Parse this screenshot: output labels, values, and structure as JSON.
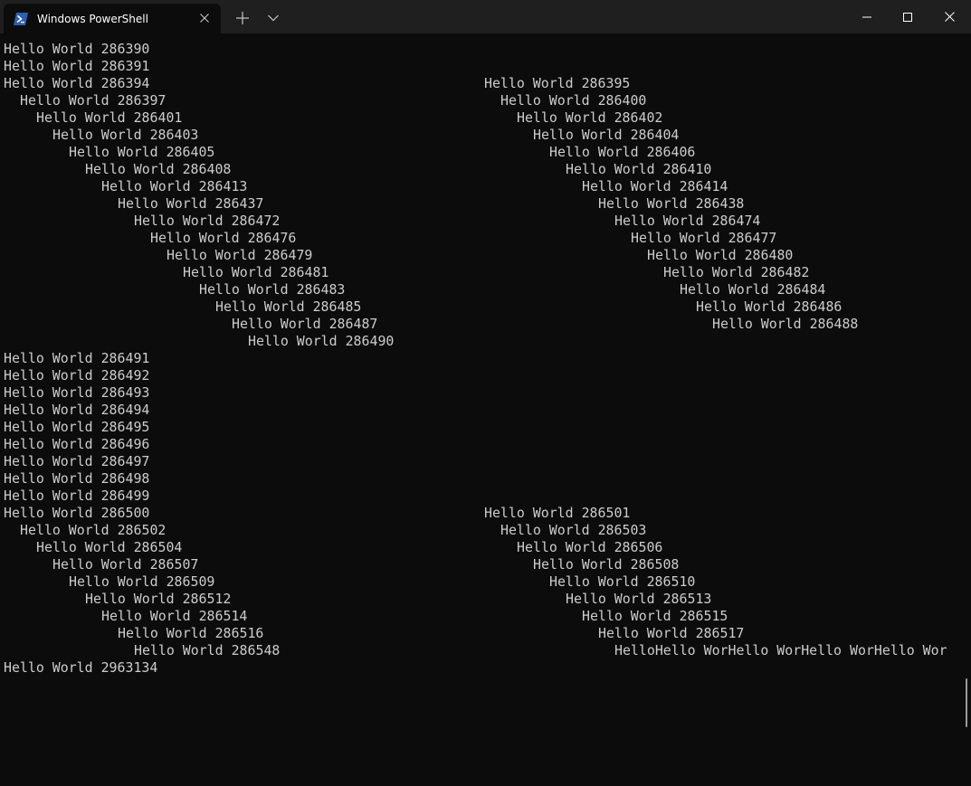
{
  "tab": {
    "title": "Windows PowerShell",
    "icon": "powershell-icon"
  },
  "titlebar": {
    "new_tab_icon": "plus-icon",
    "dropdown_icon": "chevron-down-icon",
    "minimize_icon": "minimize-icon",
    "maximize_icon": "maximize-icon",
    "close_icon": "close-icon"
  },
  "colors": {
    "background": "#0c0c0c",
    "titlebar": "#1f1f1f",
    "text": "#cccccc",
    "powershell_blue": "#2b5fb5"
  },
  "terminal": {
    "lines": [
      {
        "col": 0,
        "indent": 0,
        "text": "Hello World 286390"
      },
      {
        "col": 0,
        "indent": 0,
        "text": "Hello World 286391"
      },
      {
        "col": 0,
        "indent": 0,
        "text": "Hello World 286394"
      },
      {
        "col": 1,
        "indent": 0,
        "text": "Hello World 286395"
      },
      {
        "col": 0,
        "indent": 1,
        "text": "Hello World 286397"
      },
      {
        "col": 1,
        "indent": 1,
        "text": "Hello World 286400"
      },
      {
        "col": 0,
        "indent": 2,
        "text": "Hello World 286401"
      },
      {
        "col": 1,
        "indent": 2,
        "text": "Hello World 286402"
      },
      {
        "col": 0,
        "indent": 3,
        "text": "Hello World 286403"
      },
      {
        "col": 1,
        "indent": 3,
        "text": "Hello World 286404"
      },
      {
        "col": 0,
        "indent": 4,
        "text": "Hello World 286405"
      },
      {
        "col": 1,
        "indent": 4,
        "text": "Hello World 286406"
      },
      {
        "col": 0,
        "indent": 5,
        "text": "Hello World 286408"
      },
      {
        "col": 1,
        "indent": 5,
        "text": "Hello World 286410"
      },
      {
        "col": 0,
        "indent": 6,
        "text": "Hello World 286413"
      },
      {
        "col": 1,
        "indent": 6,
        "text": "Hello World 286414"
      },
      {
        "col": 0,
        "indent": 7,
        "text": "Hello World 286437"
      },
      {
        "col": 1,
        "indent": 7,
        "text": "Hello World 286438"
      },
      {
        "col": 0,
        "indent": 8,
        "text": "Hello World 286472"
      },
      {
        "col": 1,
        "indent": 8,
        "text": "Hello World 286474"
      },
      {
        "col": 0,
        "indent": 9,
        "text": "Hello World 286476"
      },
      {
        "col": 1,
        "indent": 9,
        "text": "Hello World 286477"
      },
      {
        "col": 0,
        "indent": 10,
        "text": "Hello World 286479"
      },
      {
        "col": 1,
        "indent": 10,
        "text": "Hello World 286480"
      },
      {
        "col": 0,
        "indent": 11,
        "text": "Hello World 286481"
      },
      {
        "col": 1,
        "indent": 11,
        "text": "Hello World 286482"
      },
      {
        "col": 0,
        "indent": 12,
        "text": "Hello World 286483"
      },
      {
        "col": 1,
        "indent": 12,
        "text": "Hello World 286484"
      },
      {
        "col": 0,
        "indent": 13,
        "text": "Hello World 286485"
      },
      {
        "col": 1,
        "indent": 13,
        "text": "Hello World 286486"
      },
      {
        "col": 0,
        "indent": 14,
        "text": "Hello World 286487"
      },
      {
        "col": 1,
        "indent": 14,
        "text": "Hello World 286488"
      },
      {
        "col": 0,
        "indent": 15,
        "text": "Hello World 286490"
      },
      {
        "col": 0,
        "indent": 0,
        "text": "Hello World 286491"
      },
      {
        "col": 0,
        "indent": 0,
        "text": "Hello World 286492"
      },
      {
        "col": 0,
        "indent": 0,
        "text": "Hello World 286493"
      },
      {
        "col": 0,
        "indent": 0,
        "text": "Hello World 286494"
      },
      {
        "col": 0,
        "indent": 0,
        "text": "Hello World 286495"
      },
      {
        "col": 0,
        "indent": 0,
        "text": "Hello World 286496"
      },
      {
        "col": 0,
        "indent": 0,
        "text": "Hello World 286497"
      },
      {
        "col": 0,
        "indent": 0,
        "text": "Hello World 286498"
      },
      {
        "col": 0,
        "indent": 0,
        "text": "Hello World 286499"
      },
      {
        "col": 0,
        "indent": 0,
        "text": "Hello World 286500"
      },
      {
        "col": 1,
        "indent": 0,
        "text": "Hello World 286501"
      },
      {
        "col": 0,
        "indent": 1,
        "text": "Hello World 286502"
      },
      {
        "col": 1,
        "indent": 1,
        "text": "Hello World 286503"
      },
      {
        "col": 0,
        "indent": 2,
        "text": "Hello World 286504"
      },
      {
        "col": 1,
        "indent": 2,
        "text": "Hello World 286506"
      },
      {
        "col": 0,
        "indent": 3,
        "text": "Hello World 286507"
      },
      {
        "col": 1,
        "indent": 3,
        "text": "Hello World 286508"
      },
      {
        "col": 0,
        "indent": 4,
        "text": "Hello World 286509"
      },
      {
        "col": 1,
        "indent": 4,
        "text": "Hello World 286510"
      },
      {
        "col": 0,
        "indent": 5,
        "text": "Hello World 286512"
      },
      {
        "col": 1,
        "indent": 5,
        "text": "Hello World 286513"
      },
      {
        "col": 0,
        "indent": 6,
        "text": "Hello World 286514"
      },
      {
        "col": 1,
        "indent": 6,
        "text": "Hello World 286515"
      },
      {
        "col": 0,
        "indent": 7,
        "text": "Hello World 286516"
      },
      {
        "col": 1,
        "indent": 7,
        "text": "Hello World 286517"
      },
      {
        "col": 0,
        "indent": 8,
        "text": "Hello World 286548"
      },
      {
        "col": 1,
        "indent": 8,
        "text": "HelloHello WorHello WorHello WorHello Wor"
      },
      {
        "col": 0,
        "indent": 0,
        "text": "Hello World 2963134"
      }
    ]
  }
}
